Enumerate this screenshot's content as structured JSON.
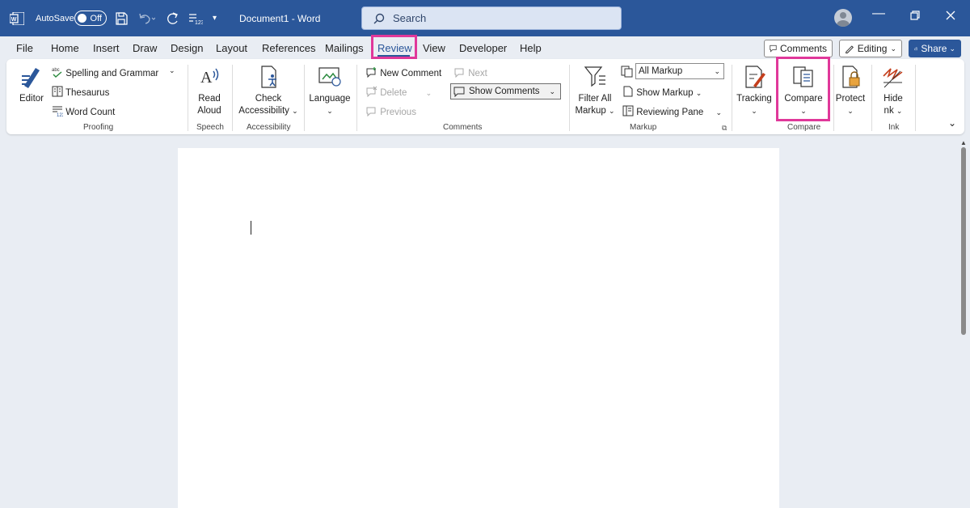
{
  "titlebar": {
    "autosave_label": "AutoSave",
    "autosave_state": "Off",
    "doc_title": "Document1  -  Word",
    "search_placeholder": "Search"
  },
  "tabs": [
    "File",
    "Home",
    "Insert",
    "Draw",
    "Design",
    "Layout",
    "References",
    "Mailings",
    "Review",
    "View",
    "Developer",
    "Help"
  ],
  "active_tab": "Review",
  "right_buttons": {
    "comments": "Comments",
    "editing": "Editing",
    "share": "Share"
  },
  "ribbon": {
    "proofing": {
      "editor": "Editor",
      "spelling": "Spelling and Grammar",
      "thesaurus": "Thesaurus",
      "word_count": "Word Count",
      "group": "Proofing"
    },
    "speech": {
      "read": "Read",
      "aloud": "Aloud",
      "group": "Speech"
    },
    "accessibility": {
      "check": "Check",
      "accessibility": "Accessibility",
      "group": "Accessibility"
    },
    "language": {
      "label": "Language"
    },
    "comments": {
      "new": "New Comment",
      "delete": "Delete",
      "previous": "Previous",
      "next": "Next",
      "show": "Show Comments",
      "group": "Comments"
    },
    "markup": {
      "filter1": "Filter All",
      "filter2": "Markup",
      "all_markup": "All Markup",
      "show_markup": "Show Markup",
      "reviewing_pane": "Reviewing Pane",
      "group": "Markup"
    },
    "tracking": {
      "label": "Tracking"
    },
    "compare": {
      "label": "Compare",
      "group": "Compare"
    },
    "protect": {
      "label": "Protect"
    },
    "ink": {
      "hide1": "Hide",
      "hide2": "nk",
      "group": "Ink"
    }
  },
  "colors": {
    "brand": "#2b579a",
    "highlight": "#e0389a"
  }
}
